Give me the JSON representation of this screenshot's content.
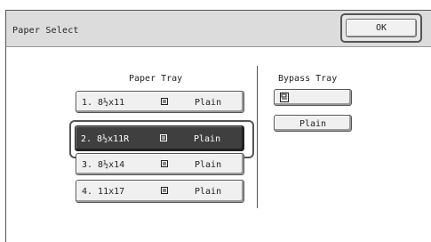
{
  "header": {
    "title": "Paper Select",
    "ok_label": "OK"
  },
  "paper_tray": {
    "heading": "Paper Tray",
    "items": [
      {
        "label": "1. 8½x11",
        "type": "Plain",
        "selected": false
      },
      {
        "label": "2. 8½x11R",
        "type": "Plain",
        "selected": true
      },
      {
        "label": "3. 8½x14",
        "type": "Plain",
        "selected": false
      },
      {
        "label": "4. 11x17",
        "type": "Plain",
        "selected": false
      }
    ]
  },
  "bypass_tray": {
    "heading": "Bypass Tray",
    "size_icon": "bypass-paper-icon",
    "type_label": "Plain"
  },
  "colors": {
    "selected_bg": "#3f3f3f",
    "button_bg": "#f0f0f0",
    "titlebar_bg": "#dcdcdc"
  }
}
